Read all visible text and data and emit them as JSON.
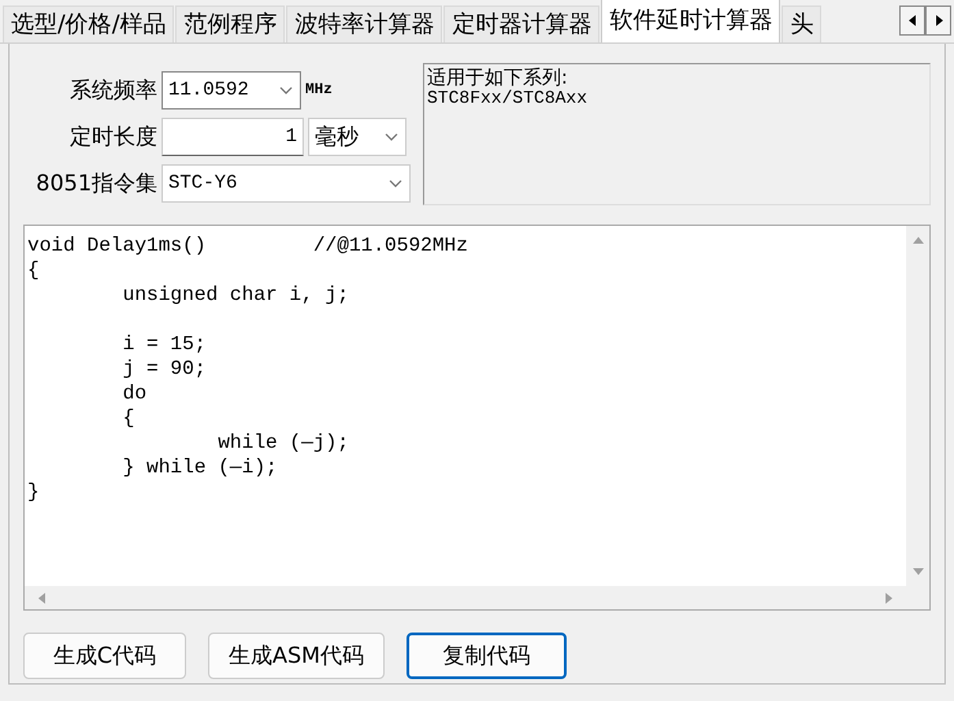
{
  "tabs": [
    {
      "label": "选型/价格/样品",
      "selected": false
    },
    {
      "label": "范例程序",
      "selected": false
    },
    {
      "label": "波特率计算器",
      "selected": false
    },
    {
      "label": "定时器计算器",
      "selected": false
    },
    {
      "label": "软件延时计算器",
      "selected": true
    },
    {
      "label": "头",
      "selected": false
    }
  ],
  "form": {
    "rows": [
      {
        "label": "系统频率",
        "kind": "combo",
        "value": "11.0592",
        "unit": "MHz"
      },
      {
        "label": "定时长度",
        "kind": "number",
        "value": "1",
        "unit_select": "毫秒"
      },
      {
        "label": "8051指令集",
        "kind": "select",
        "value": "STC-Y6"
      }
    ]
  },
  "info": {
    "title": "适用于如下系列:",
    "series": "STC8Fxx/STC8Axx"
  },
  "code": [
    [
      "void Delay1ms()         //@11.0592MHz",
      "{",
      "        unsigned char i, j;"
    ],
    [
      "        i = 15;",
      "        j = 90;",
      "        do",
      "        {",
      "                while (—j);",
      "        } while (—i);",
      "}"
    ]
  ],
  "buttons": [
    {
      "label": "生成C代码",
      "focused": false
    },
    {
      "label": "生成ASM代码",
      "focused": false
    },
    {
      "label": "复制代码",
      "focused": true
    }
  ]
}
